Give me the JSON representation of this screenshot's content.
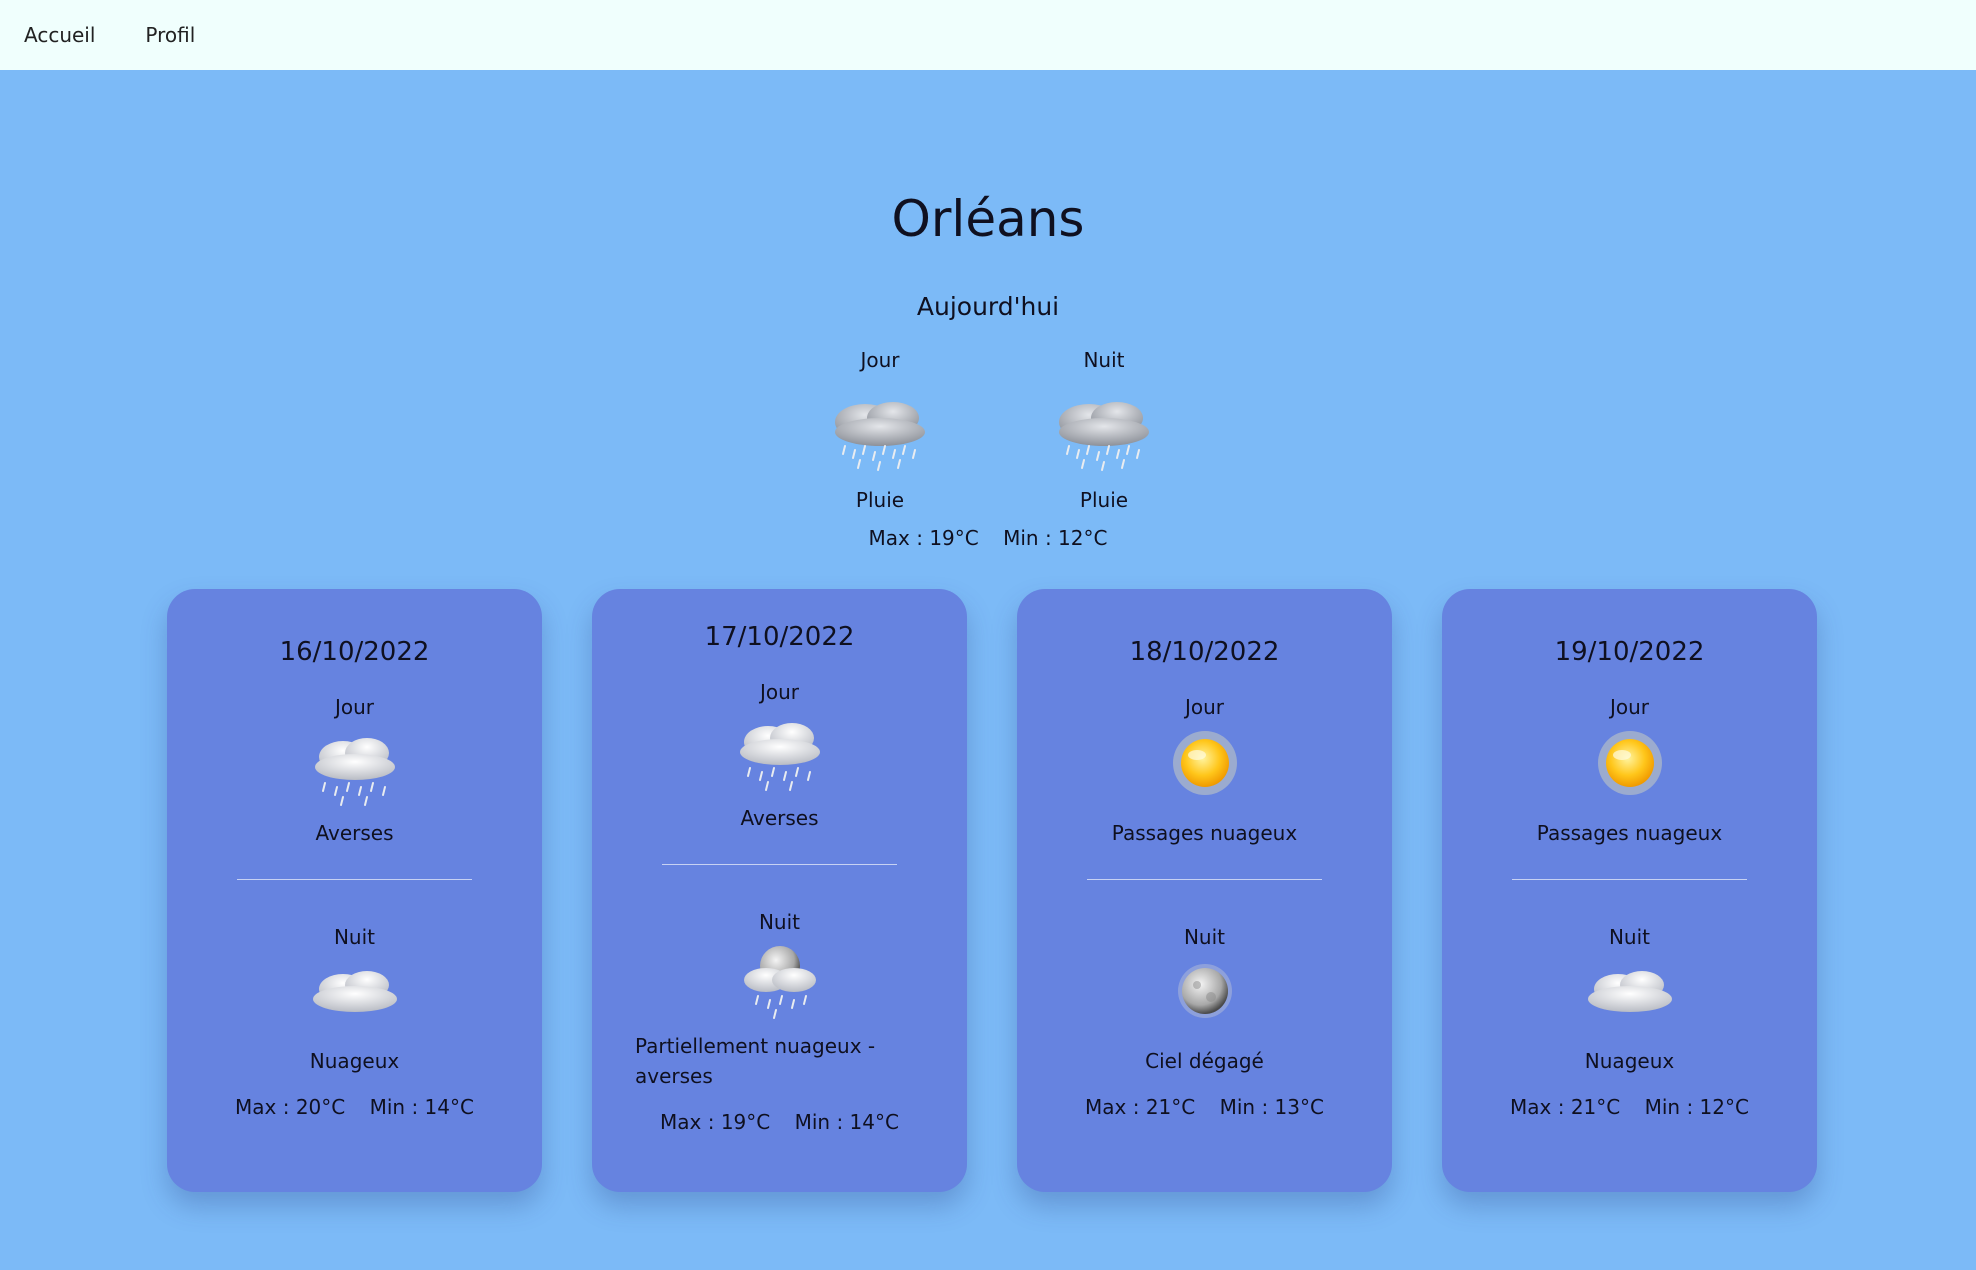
{
  "nav": {
    "home": "Accueil",
    "profile": "Profil"
  },
  "city": "Orléans",
  "today": {
    "title": "Aujourd'hui",
    "day_label": "Jour",
    "day_icon": "rain-cloud-icon",
    "day_desc": "Pluie",
    "night_label": "Nuit",
    "night_icon": "rain-cloud-icon",
    "night_desc": "Pluie",
    "max": "Max : 19°C",
    "min": "Min : 12°C"
  },
  "forecast": [
    {
      "date": "16/10/2022",
      "day_label": "Jour",
      "day_icon": "showers-icon",
      "day_desc": "Averses",
      "night_label": "Nuit",
      "night_icon": "cloud-icon",
      "night_desc": "Nuageux",
      "max": "Max : 20°C",
      "min": "Min : 14°C"
    },
    {
      "date": "17/10/2022",
      "day_label": "Jour",
      "day_icon": "showers-icon",
      "day_desc": "Averses",
      "night_label": "Nuit",
      "night_icon": "moon-cloud-rain-icon",
      "night_desc": "Partiellement nuageux - averses",
      "max": "Max : 19°C",
      "min": "Min : 14°C"
    },
    {
      "date": "18/10/2022",
      "day_label": "Jour",
      "day_icon": "sun-icon",
      "day_desc": "Passages nuageux",
      "night_label": "Nuit",
      "night_icon": "moon-icon",
      "night_desc": "Ciel dégagé",
      "max": "Max : 21°C",
      "min": "Min : 13°C"
    },
    {
      "date": "19/10/2022",
      "day_label": "Jour",
      "day_icon": "sun-icon",
      "day_desc": "Passages nuageux",
      "night_label": "Nuit",
      "night_icon": "cloud-icon",
      "night_desc": "Nuageux",
      "max": "Max : 21°C",
      "min": "Min : 12°C"
    }
  ],
  "colors": {
    "page_background": "#7cbaf7",
    "nav_background": "#f0fffd",
    "card_background": "#6683e0",
    "text": "#0f1020"
  }
}
